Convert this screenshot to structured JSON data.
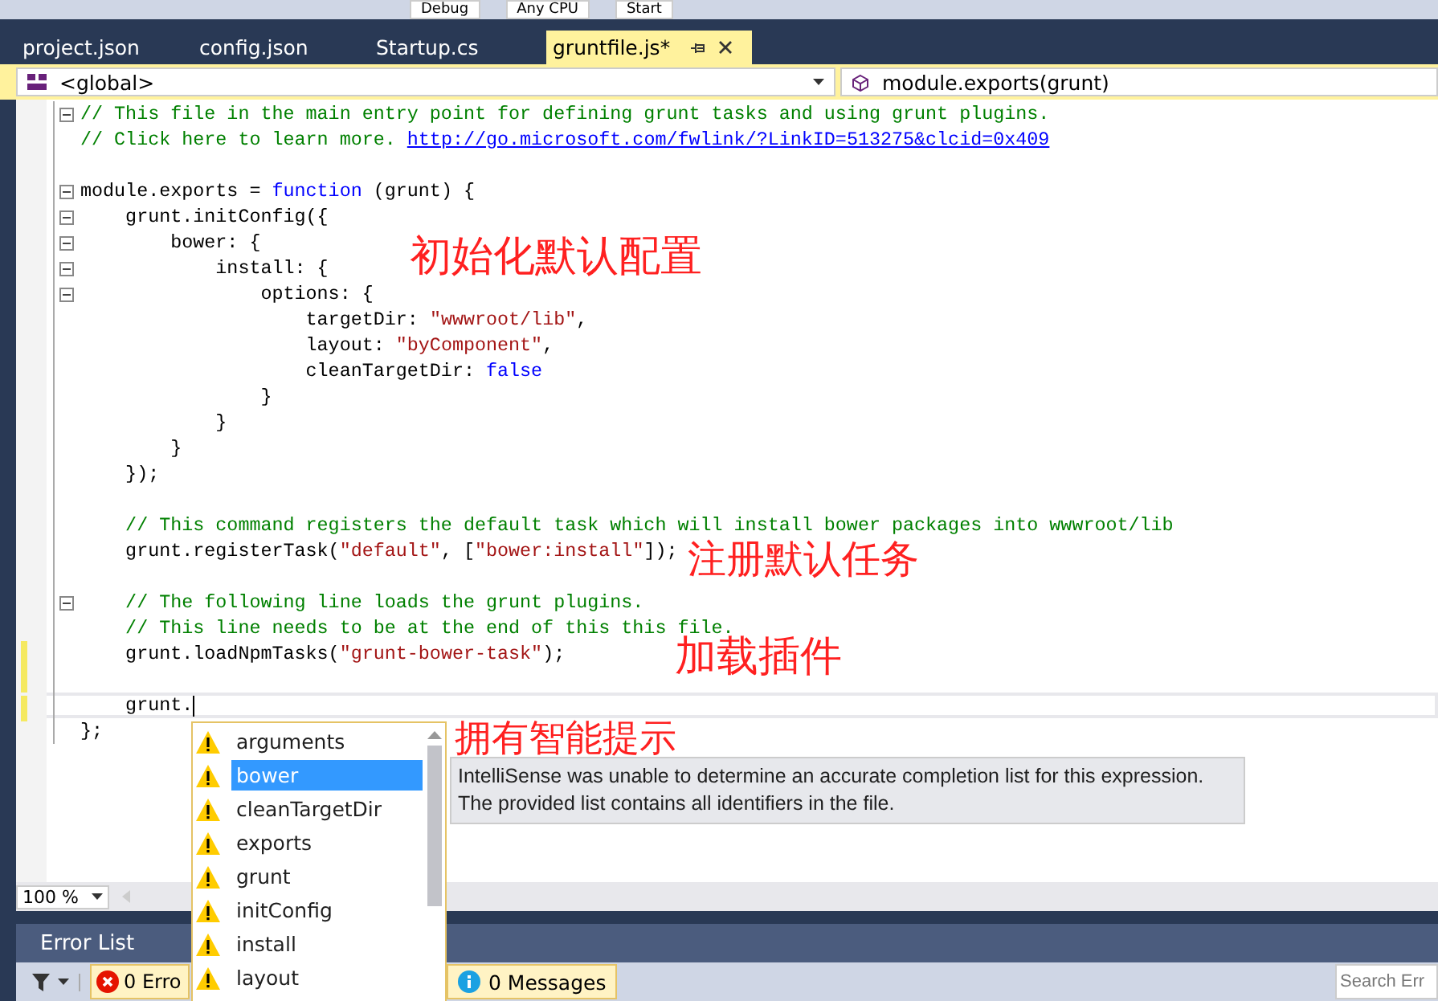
{
  "toolbar": {
    "items": [
      "Debug",
      "Any CPU",
      "Start"
    ]
  },
  "tabs": [
    {
      "label": "project.json",
      "selected": false
    },
    {
      "label": "config.json",
      "selected": false
    },
    {
      "label": "Startup.cs",
      "selected": false
    },
    {
      "label": "gruntfile.js*",
      "selected": true
    }
  ],
  "nav_bar": {
    "scope": "<global>",
    "member": "module.exports(grunt)"
  },
  "code_lines": [
    {
      "kind": "code",
      "fold": true,
      "changed": false,
      "current": false,
      "tokens": [
        {
          "kind": "comment",
          "text": "// This file in the main entry point for defining grunt tasks and using grunt plugins."
        }
      ]
    },
    {
      "kind": "code",
      "fold": false,
      "changed": false,
      "current": false,
      "tokens": [
        {
          "kind": "comment",
          "text": "// Click here to learn more. "
        },
        {
          "kind": "link",
          "text": "http://go.microsoft.com/fwlink/?LinkID=513275&clcid=0x409"
        }
      ]
    },
    {
      "kind": "blank",
      "fold": false,
      "changed": false,
      "current": false
    },
    {
      "kind": "code",
      "fold": true,
      "changed": false,
      "current": false,
      "tokens": [
        {
          "kind": "plain",
          "text": "module.exports = "
        },
        {
          "kind": "keyword",
          "text": "function"
        },
        {
          "kind": "plain",
          "text": " (grunt) {"
        }
      ]
    },
    {
      "kind": "code",
      "fold": true,
      "changed": false,
      "current": false,
      "tokens": [
        {
          "kind": "plain",
          "text": "    grunt.initConfig({"
        }
      ]
    },
    {
      "kind": "code",
      "fold": true,
      "changed": false,
      "current": false,
      "tokens": [
        {
          "kind": "plain",
          "text": "        bower: {"
        }
      ]
    },
    {
      "kind": "code",
      "fold": true,
      "changed": false,
      "current": false,
      "tokens": [
        {
          "kind": "plain",
          "text": "            install: {"
        }
      ]
    },
    {
      "kind": "code",
      "fold": true,
      "changed": false,
      "current": false,
      "tokens": [
        {
          "kind": "plain",
          "text": "                options: {"
        }
      ]
    },
    {
      "kind": "code",
      "fold": false,
      "changed": false,
      "current": false,
      "tokens": [
        {
          "kind": "plain",
          "text": "                    targetDir: "
        },
        {
          "kind": "string",
          "text": "\"wwwroot/lib\""
        },
        {
          "kind": "plain",
          "text": ","
        }
      ]
    },
    {
      "kind": "code",
      "fold": false,
      "changed": false,
      "current": false,
      "tokens": [
        {
          "kind": "plain",
          "text": "                    layout: "
        },
        {
          "kind": "string",
          "text": "\"byComponent\""
        },
        {
          "kind": "plain",
          "text": ","
        }
      ]
    },
    {
      "kind": "code",
      "fold": false,
      "changed": false,
      "current": false,
      "tokens": [
        {
          "kind": "plain",
          "text": "                    cleanTargetDir: "
        },
        {
          "kind": "keyword",
          "text": "false"
        }
      ]
    },
    {
      "kind": "code",
      "fold": false,
      "changed": false,
      "current": false,
      "tokens": [
        {
          "kind": "plain",
          "text": "                }"
        }
      ]
    },
    {
      "kind": "code",
      "fold": false,
      "changed": false,
      "current": false,
      "tokens": [
        {
          "kind": "plain",
          "text": "            }"
        }
      ]
    },
    {
      "kind": "code",
      "fold": false,
      "changed": false,
      "current": false,
      "tokens": [
        {
          "kind": "plain",
          "text": "        }"
        }
      ]
    },
    {
      "kind": "code",
      "fold": false,
      "changed": false,
      "current": false,
      "tokens": [
        {
          "kind": "plain",
          "text": "    });"
        }
      ]
    },
    {
      "kind": "blank",
      "fold": false,
      "changed": false,
      "current": false
    },
    {
      "kind": "code",
      "fold": false,
      "changed": false,
      "current": false,
      "tokens": [
        {
          "kind": "comment",
          "text": "    // This command registers the default task which will install bower packages into wwwroot/lib"
        }
      ]
    },
    {
      "kind": "code",
      "fold": false,
      "changed": false,
      "current": false,
      "tokens": [
        {
          "kind": "plain",
          "text": "    grunt.registerTask("
        },
        {
          "kind": "string",
          "text": "\"default\""
        },
        {
          "kind": "plain",
          "text": ", ["
        },
        {
          "kind": "string",
          "text": "\"bower:install\""
        },
        {
          "kind": "plain",
          "text": "]);"
        }
      ]
    },
    {
      "kind": "blank",
      "fold": false,
      "changed": false,
      "current": false
    },
    {
      "kind": "code",
      "fold": true,
      "changed": false,
      "current": false,
      "tokens": [
        {
          "kind": "comment",
          "text": "    // The following line loads the grunt plugins."
        }
      ]
    },
    {
      "kind": "code",
      "fold": false,
      "changed": false,
      "current": false,
      "tokens": [
        {
          "kind": "comment",
          "text": "    // This line needs to be at the end of this this file."
        }
      ]
    },
    {
      "kind": "code",
      "fold": false,
      "changed": true,
      "current": false,
      "tokens": [
        {
          "kind": "plain",
          "text": "    grunt.loadNpmTasks("
        },
        {
          "kind": "string",
          "text": "\"grunt-bower-task\""
        },
        {
          "kind": "plain",
          "text": ");"
        }
      ]
    },
    {
      "kind": "blank",
      "fold": false,
      "changed": true,
      "current": false
    },
    {
      "kind": "code",
      "fold": false,
      "changed": true,
      "current": true,
      "tokens": [
        {
          "kind": "plain",
          "text": "    grunt."
        }
      ]
    },
    {
      "kind": "code",
      "fold": false,
      "changed": false,
      "current": false,
      "tokens": [
        {
          "kind": "plain",
          "text": "};"
        }
      ]
    }
  ],
  "annotations": [
    "初始化默认配置",
    "注册默认任务",
    "加载插件",
    "拥有智能提示"
  ],
  "completion_list": [
    {
      "label": "arguments",
      "selected": false
    },
    {
      "label": "bower",
      "selected": true
    },
    {
      "label": "cleanTargetDir",
      "selected": false
    },
    {
      "label": "exports",
      "selected": false
    },
    {
      "label": "grunt",
      "selected": false
    },
    {
      "label": "initConfig",
      "selected": false
    },
    {
      "label": "install",
      "selected": false
    },
    {
      "label": "layout",
      "selected": false
    }
  ],
  "tooltip": [
    "IntelliSense was unable to determine an accurate completion list for this expression.",
    "The provided list contains all identifiers in the file."
  ],
  "zoom": "100 %",
  "error_list": {
    "title": "Error List",
    "errors": "0 Erro",
    "messages": "0 Messages",
    "search": {
      "placeholder": "Search Err"
    }
  }
}
